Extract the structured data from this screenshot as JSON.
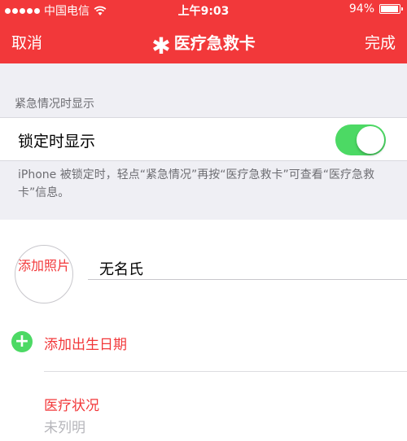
{
  "status_bar": {
    "carrier": "中国电信",
    "time": "上午9:03",
    "battery": "94%"
  },
  "nav": {
    "cancel": "取消",
    "title": "医疗急救卡",
    "title_icon": "asterisk-icon",
    "done": "完成"
  },
  "lock_section": {
    "header": "紧急情况时显示",
    "toggle_label": "锁定时显示",
    "toggle_on": true,
    "footer": "iPhone 被锁定时，轻点“紧急情况”再按“医疗急救卡”可查看“医疗急救卡”信息。"
  },
  "profile": {
    "add_photo": "添加照片",
    "name_value": "无名氏",
    "add_birthdate": "添加出生日期"
  },
  "medical_conditions": {
    "label": "医疗状况",
    "value": "未列明"
  },
  "colors": {
    "accent": "#f2383a",
    "toggle_green": "#4cd964",
    "group_background": "#efeff4"
  }
}
